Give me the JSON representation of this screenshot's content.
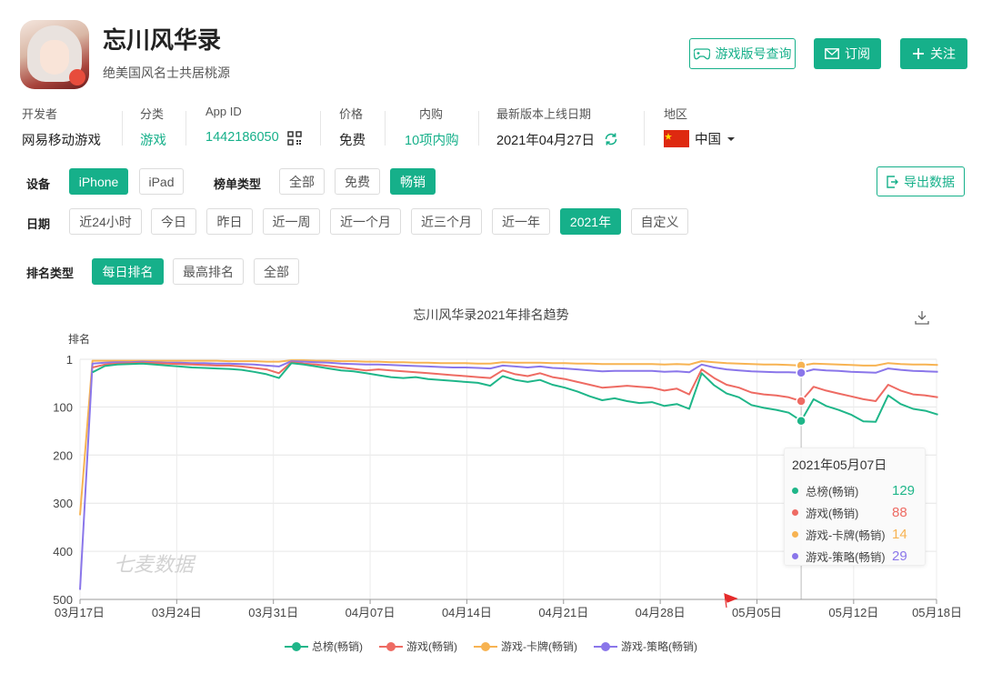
{
  "app": {
    "title": "忘川风华录",
    "subtitle": "绝美国风名士共居桃源"
  },
  "header_buttons": {
    "version_query": "游戏版号查询",
    "subscribe": "订阅",
    "follow": "关注"
  },
  "meta": {
    "developer_label": "开发者",
    "developer_value": "网易移动游戏",
    "category_label": "分类",
    "category_value": "游戏",
    "appid_label": "App ID",
    "appid_value": "1442186050",
    "price_label": "价格",
    "price_value": "免费",
    "iap_label": "内购",
    "iap_value": "10项内购",
    "release_label": "最新版本上线日期",
    "release_value": "2021年04月27日",
    "region_label": "地区",
    "region_value": "中国"
  },
  "filters": {
    "device_label": "设备",
    "device_options": [
      "iPhone",
      "iPad"
    ],
    "chart_type_label": "榜单类型",
    "chart_type_options": [
      "全部",
      "免费",
      "畅销"
    ],
    "export": "导出数据",
    "date_label": "日期",
    "date_options": [
      "近24小时",
      "今日",
      "昨日",
      "近一周",
      "近一个月",
      "近三个月",
      "近一年",
      "2021年",
      "自定义"
    ],
    "rank_type_label": "排名类型",
    "rank_type_options": [
      "每日排名",
      "最高排名",
      "全部"
    ]
  },
  "colors": {
    "accent": "#16b08a",
    "total": "#1fb689",
    "game": "#ee6b63",
    "card": "#f7b352",
    "strategy": "#8a76ea"
  },
  "chart_data": {
    "type": "line",
    "title": "忘川风华录2021年排名趋势",
    "ylabel": "排名",
    "y_inverted": true,
    "ylim": [
      1,
      500
    ],
    "y_ticks": [
      1,
      100,
      200,
      300,
      400,
      500
    ],
    "x_tick_labels": [
      "03月17日",
      "03月24日",
      "03月31日",
      "04月07日",
      "04月14日",
      "04月21日",
      "04月28日",
      "05月05日",
      "05月12日",
      "05月18日"
    ],
    "x_tick_days": [
      0,
      7,
      14,
      21,
      28,
      35,
      42,
      49,
      56,
      62
    ],
    "watermark": "七麦数据",
    "series": [
      {
        "name": "总榜(畅销)",
        "color_key": "total",
        "values": [
          null,
          28,
          15,
          12,
          11,
          10,
          12,
          14,
          16,
          18,
          19,
          20,
          21,
          23,
          27,
          32,
          40,
          9,
          12,
          16,
          20,
          24,
          26,
          30,
          34,
          38,
          40,
          38,
          42,
          44,
          46,
          48,
          50,
          56,
          36,
          44,
          48,
          44,
          54,
          60,
          68,
          78,
          86,
          82,
          88,
          92,
          90,
          98,
          94,
          104,
          30,
          55,
          72,
          80,
          96,
          102,
          106,
          112,
          129,
          84,
          98,
          106,
          116,
          130,
          131,
          76,
          94,
          104,
          108,
          116
        ]
      },
      {
        "name": "游戏(畅销)",
        "color_key": "game",
        "values": [
          null,
          18,
          12,
          10,
          9,
          8,
          9,
          10,
          11,
          12,
          13,
          14,
          14,
          16,
          19,
          22,
          30,
          7,
          10,
          12,
          15,
          18,
          21,
          24,
          22,
          24,
          26,
          28,
          30,
          32,
          34,
          36,
          38,
          40,
          24,
          32,
          36,
          30,
          38,
          42,
          48,
          54,
          60,
          58,
          56,
          58,
          60,
          66,
          62,
          74,
          22,
          40,
          54,
          60,
          70,
          74,
          76,
          80,
          88,
          58,
          66,
          72,
          78,
          84,
          88,
          54,
          66,
          74,
          76,
          80
        ]
      },
      {
        "name": "游戏-卡牌(畅销)",
        "color_key": "card",
        "values": [
          325,
          4,
          4,
          4,
          4,
          4,
          4,
          4,
          4,
          4,
          4,
          4,
          5,
          5,
          5,
          6,
          6,
          3,
          3,
          4,
          4,
          5,
          5,
          6,
          6,
          7,
          7,
          8,
          8,
          9,
          9,
          9,
          10,
          10,
          7,
          8,
          8,
          8,
          9,
          9,
          10,
          10,
          11,
          11,
          11,
          11,
          11,
          12,
          11,
          12,
          5,
          7,
          9,
          10,
          11,
          12,
          12,
          13,
          14,
          10,
          11,
          12,
          13,
          14,
          14,
          9,
          11,
          12,
          12,
          13
        ]
      },
      {
        "name": "游戏-策略(畅销)",
        "color_key": "strategy",
        "values": [
          480,
          10,
          8,
          7,
          7,
          6,
          7,
          8,
          8,
          9,
          9,
          10,
          10,
          11,
          12,
          14,
          16,
          5,
          6,
          7,
          8,
          10,
          11,
          12,
          12,
          13,
          14,
          15,
          16,
          17,
          18,
          18,
          19,
          20,
          14,
          16,
          18,
          16,
          19,
          20,
          22,
          24,
          26,
          25,
          25,
          25,
          25,
          27,
          26,
          28,
          12,
          18,
          22,
          24,
          26,
          27,
          28,
          28,
          29,
          22,
          24,
          25,
          27,
          28,
          29,
          20,
          23,
          25,
          26,
          27
        ]
      }
    ],
    "x_day_step": 0.9,
    "highlight_index": 58,
    "tooltip": {
      "date": "2021年05月07日",
      "values": [
        129,
        88,
        14,
        29
      ]
    },
    "legend_position": "bottom-center",
    "grid": true
  }
}
